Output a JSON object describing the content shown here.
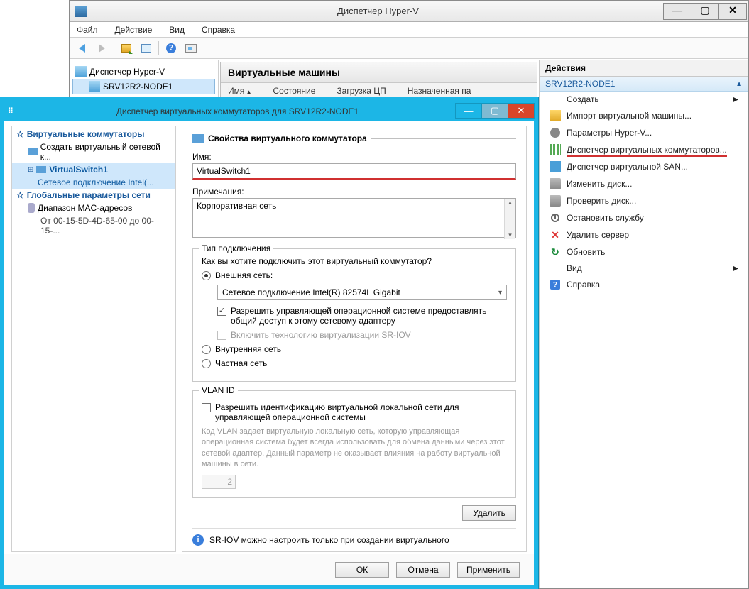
{
  "hv": {
    "title": "Диспетчер Hyper-V",
    "menu": {
      "file": "Файл",
      "action": "Действие",
      "view": "Вид",
      "help": "Справка"
    },
    "tree": {
      "root": "Диспетчер Hyper-V",
      "node": "SRV12R2-NODE1"
    },
    "vm": {
      "heading": "Виртуальные машины",
      "cols": {
        "name": "Имя",
        "state": "Состояние",
        "cpu": "Загрузка ЦП",
        "mem": "Назначенная па"
      }
    },
    "actions": {
      "head": "Действия",
      "node": "SRV12R2-NODE1",
      "create": "Создать",
      "import": "Импорт виртуальной машины...",
      "params": "Параметры Hyper-V...",
      "vswitch": "Диспетчер виртуальных коммутаторов...",
      "vsan": "Диспетчер виртуальной SAN...",
      "edit_disk": "Изменить диск...",
      "check_disk": "Проверить диск...",
      "stop_svc": "Остановить службу",
      "del_server": "Удалить сервер",
      "refresh": "Обновить",
      "view": "Вид",
      "help": "Справка"
    }
  },
  "vsm": {
    "title": "Диспетчер виртуальных коммутаторов для SRV12R2-NODE1",
    "tree": {
      "switches": "Виртуальные коммутаторы",
      "create_new": "Создать виртуальный сетевой к...",
      "vs1": "VirtualSwitch1",
      "vs1_sub": "Сетевое подключение Intel(...",
      "global": "Глобальные параметры сети",
      "macrange": "Диапазон MAC-адресов",
      "macrange_sub": "От 00-15-5D-4D-65-00 до 00-15-..."
    },
    "props": {
      "heading": "Свойства виртуального коммутатора",
      "name_label": "Имя:",
      "name_value": "VirtualSwitch1",
      "notes_label": "Примечания:",
      "notes_value": "Корпоративная сеть"
    },
    "conn": {
      "legend": "Тип подключения",
      "question": "Как вы хотите подключить этот виртуальный коммутатор?",
      "external": "Внешняя сеть:",
      "adapter": "Сетевое подключение Intel(R) 82574L Gigabit",
      "mgmt_share": "Разрешить управляющей операционной системе предоставлять общий доступ к этому сетевому адаптеру",
      "sriov": "Включить технологию виртуализации SR-IOV",
      "internal": "Внутренняя сеть",
      "private": "Частная сеть"
    },
    "vlan": {
      "legend": "VLAN ID",
      "enable": "Разрешить идентификацию виртуальной локальной сети для управляющей операционной системы",
      "desc": "Код VLAN задает виртуальную локальную сеть, которую управляющая операционная система будет всегда использовать для обмена данными через этот сетевой адаптер. Данный параметр не оказывает влияния на работу виртуальной машины в сети.",
      "value": "2"
    },
    "delete_btn": "Удалить",
    "info_note": "SR-IOV можно настроить только при создании виртуального",
    "buttons": {
      "ok": "ОК",
      "cancel": "Отмена",
      "apply": "Применить"
    }
  }
}
